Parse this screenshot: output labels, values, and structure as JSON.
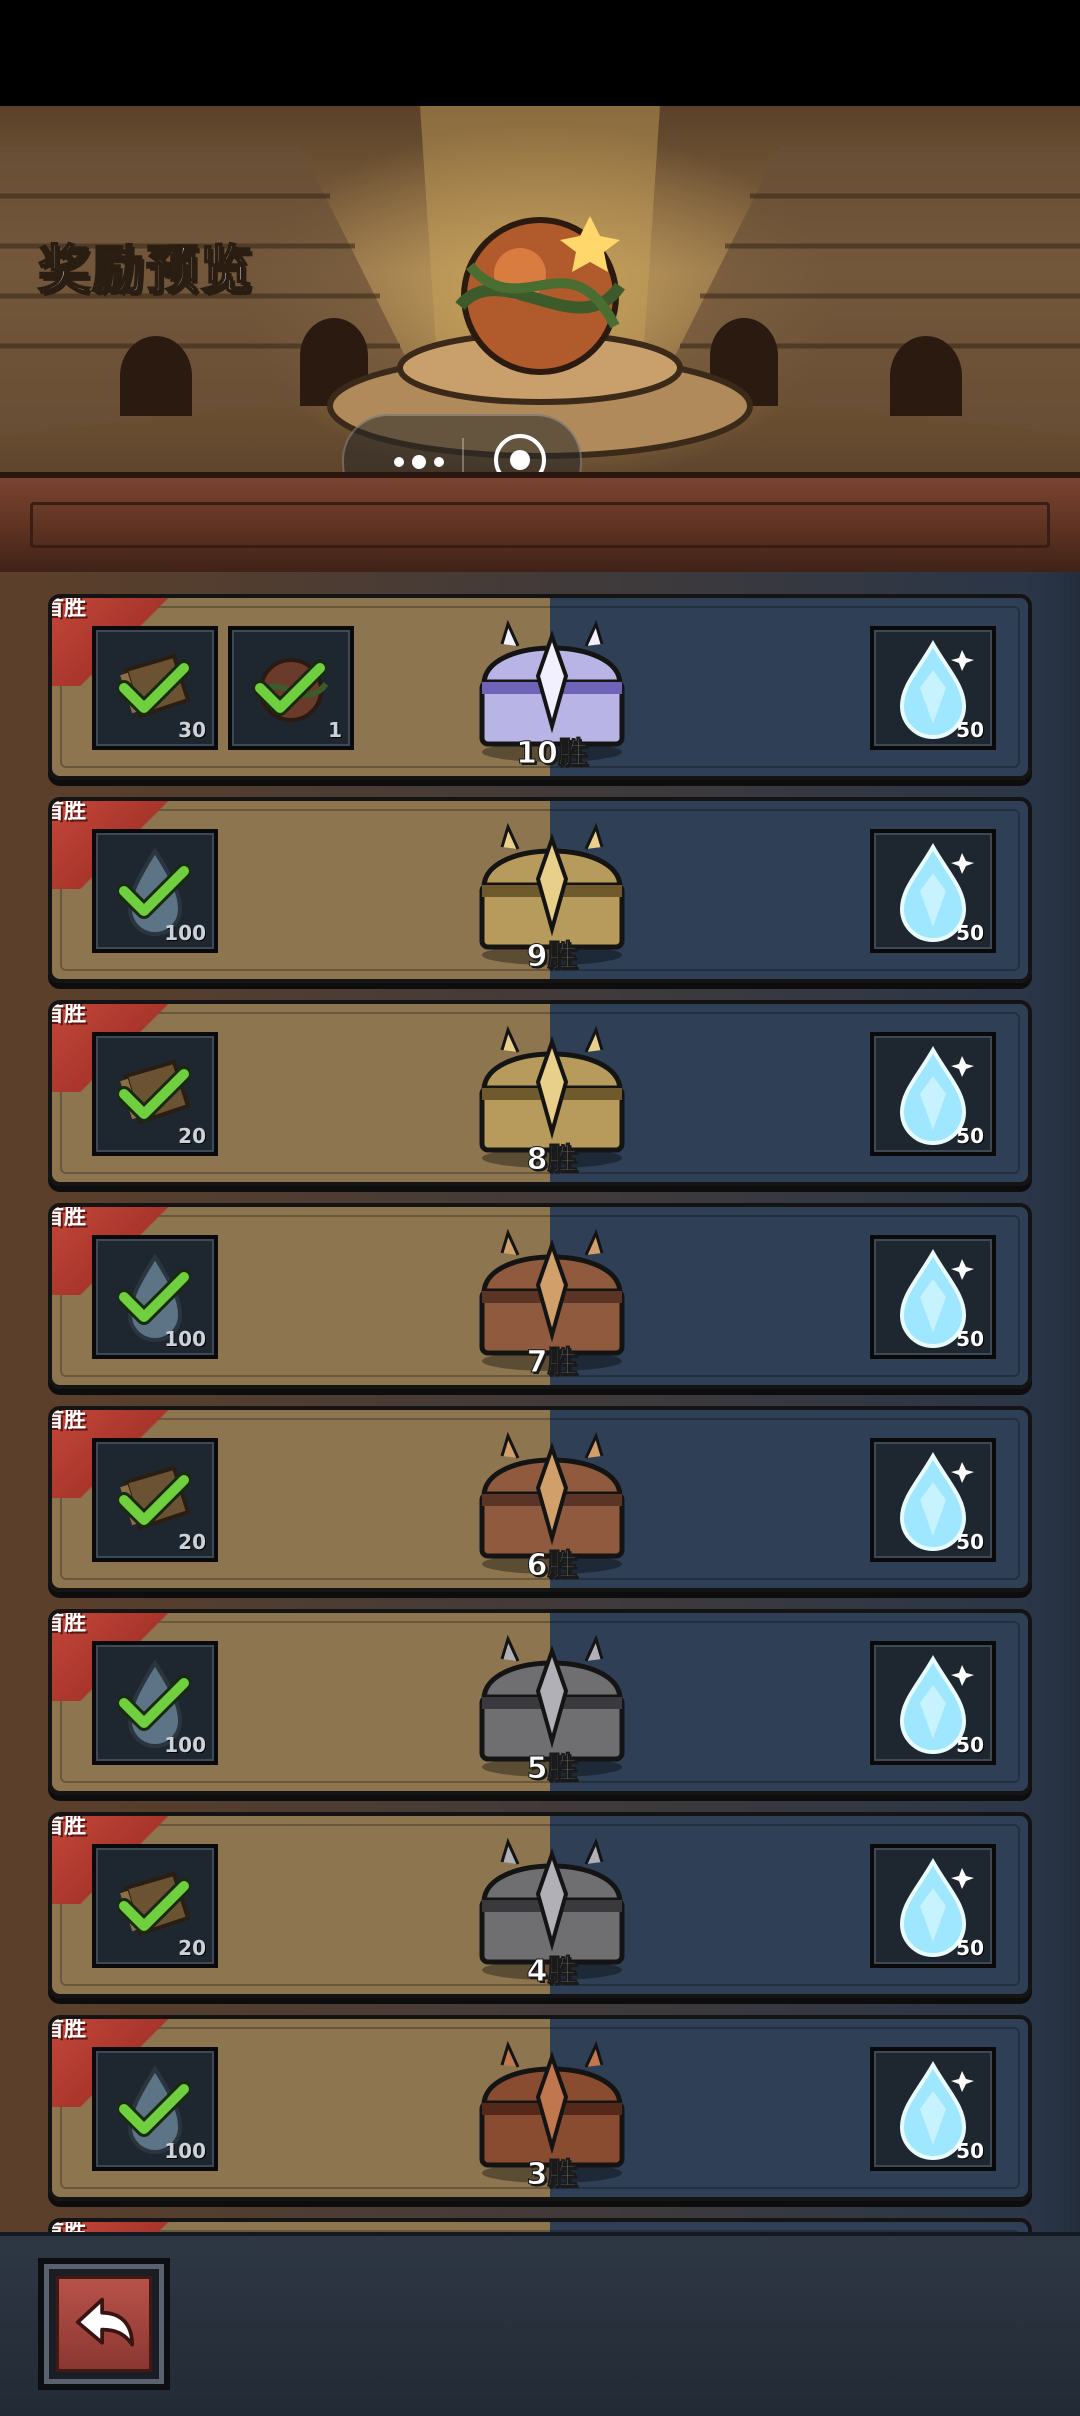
{
  "header": {
    "title": "奖励预览"
  },
  "capsule": {
    "more_icon": "more-dots-icon",
    "close_icon": "record-circle-icon"
  },
  "colors": {
    "left_panel": "#8d7550",
    "right_panel": "#2f4056",
    "ribbon": "#c94a3c",
    "check": "#6fcf3f",
    "gem": "#9fe6ff"
  },
  "rows": [
    {
      "badge": "首胜",
      "chest_label": "10胜",
      "chest_tier": "crystal",
      "rewards": [
        {
          "icon": "scroll-icon",
          "qty": "30",
          "claimed": true
        },
        {
          "icon": "thorn-egg-icon",
          "qty": "1",
          "claimed": true
        }
      ],
      "gem": {
        "icon": "diamond-gem-icon",
        "qty": "50"
      }
    },
    {
      "badge": "首胜",
      "chest_label": "9胜",
      "chest_tier": "gold",
      "rewards": [
        {
          "icon": "water-drop-icon",
          "qty": "100",
          "claimed": true
        }
      ],
      "gem": {
        "icon": "diamond-gem-icon",
        "qty": "50"
      }
    },
    {
      "badge": "首胜",
      "chest_label": "8胜",
      "chest_tier": "gold",
      "rewards": [
        {
          "icon": "scroll-icon",
          "qty": "20",
          "claimed": true
        }
      ],
      "gem": {
        "icon": "diamond-gem-icon",
        "qty": "50"
      }
    },
    {
      "badge": "首胜",
      "chest_label": "7胜",
      "chest_tier": "bronze",
      "rewards": [
        {
          "icon": "water-drop-icon",
          "qty": "100",
          "claimed": true
        }
      ],
      "gem": {
        "icon": "diamond-gem-icon",
        "qty": "50"
      }
    },
    {
      "badge": "首胜",
      "chest_label": "6胜",
      "chest_tier": "bronze",
      "rewards": [
        {
          "icon": "scroll-icon",
          "qty": "20",
          "claimed": true
        }
      ],
      "gem": {
        "icon": "diamond-gem-icon",
        "qty": "50"
      }
    },
    {
      "badge": "首胜",
      "chest_label": "5胜",
      "chest_tier": "iron",
      "rewards": [
        {
          "icon": "water-drop-icon",
          "qty": "100",
          "claimed": true
        }
      ],
      "gem": {
        "icon": "diamond-gem-icon",
        "qty": "50"
      }
    },
    {
      "badge": "首胜",
      "chest_label": "4胜",
      "chest_tier": "iron",
      "rewards": [
        {
          "icon": "scroll-icon",
          "qty": "20",
          "claimed": true
        }
      ],
      "gem": {
        "icon": "diamond-gem-icon",
        "qty": "50"
      }
    },
    {
      "badge": "首胜",
      "chest_label": "3胜",
      "chest_tier": "wood",
      "rewards": [
        {
          "icon": "water-drop-icon",
          "qty": "100",
          "claimed": true
        }
      ],
      "gem": {
        "icon": "diamond-gem-icon",
        "qty": "50"
      }
    },
    {
      "badge": "首胜",
      "chest_label": "",
      "chest_tier": "partial",
      "rewards": [],
      "gem": null
    }
  ],
  "footer": {
    "back_icon": "back-arrow-icon"
  }
}
